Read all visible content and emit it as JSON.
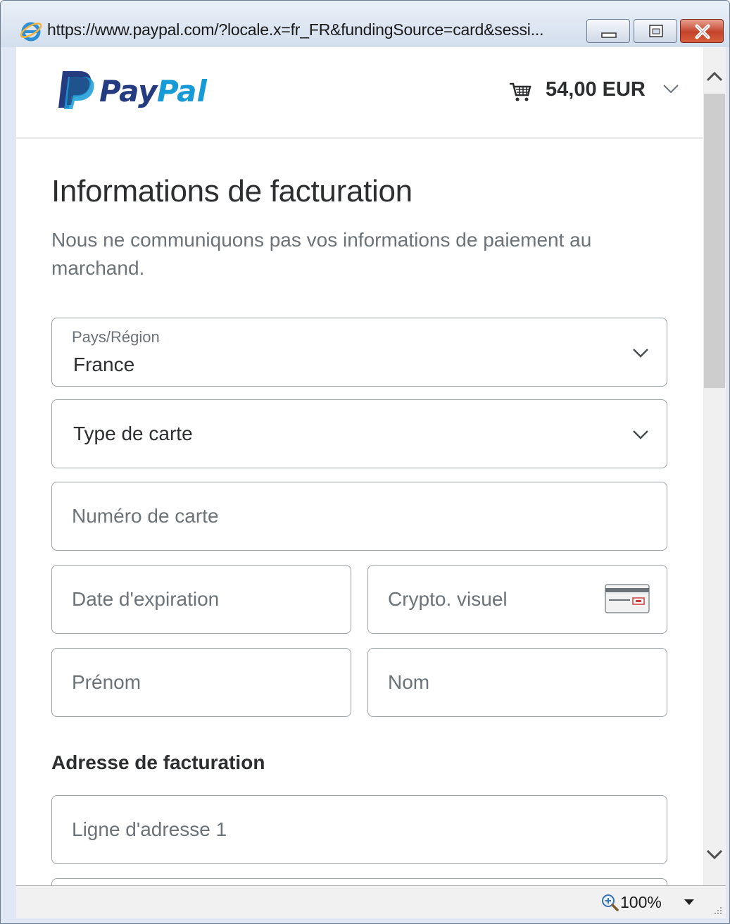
{
  "window": {
    "url": "https://www.paypal.com/?locale.x=fr_FR&fundingSource=card&sessi..."
  },
  "header": {
    "brand": "PayPal",
    "amount": "54,00 EUR"
  },
  "form": {
    "title": "Informations de facturation",
    "description": "Nous ne communiquons pas vos informations de paiement au marchand.",
    "country": {
      "label": "Pays/Région",
      "value": "France"
    },
    "card_type": {
      "value": "Type de carte"
    },
    "card_number": {
      "placeholder": "Numéro de carte"
    },
    "expiry": {
      "placeholder": "Date d'expiration"
    },
    "cvv": {
      "placeholder": "Crypto. visuel"
    },
    "first_name": {
      "placeholder": "Prénom"
    },
    "last_name": {
      "placeholder": "Nom"
    },
    "billing_section": "Adresse de facturation",
    "address_line_1": {
      "placeholder": "Ligne d'adresse 1"
    }
  },
  "statusbar": {
    "zoom": "100%"
  },
  "colors": {
    "paypal_dark_blue": "#253b80",
    "paypal_light_blue": "#179bd7",
    "text_dark": "#2c2e2f",
    "text_muted": "#6c7378",
    "field_border": "#9da3a6"
  }
}
